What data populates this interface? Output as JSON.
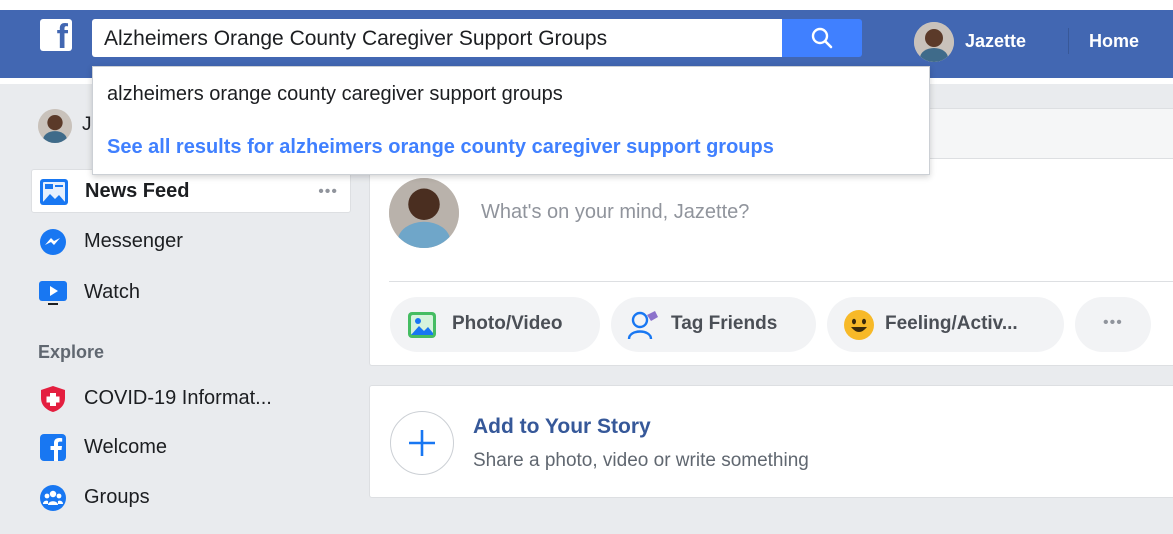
{
  "header": {
    "search_value": "Alzheimers Orange County Caregiver Support Groups",
    "user_name": "Jazette",
    "home_label": "Home"
  },
  "search_dropdown": {
    "suggestion": "alzheimers orange county caregiver support groups",
    "see_all": "See all results for alzheimers orange county caregiver support groups"
  },
  "sidebar": {
    "user_initial": "J",
    "items": [
      {
        "label": "News Feed",
        "icon": "news-feed-icon",
        "more": "•••"
      },
      {
        "label": "Messenger",
        "icon": "messenger-icon"
      },
      {
        "label": "Watch",
        "icon": "watch-icon"
      }
    ],
    "explore_heading": "Explore",
    "explore_items": [
      {
        "label": "COVID-19 Informat...",
        "icon": "covid-shield-icon"
      },
      {
        "label": "Welcome",
        "icon": "facebook-icon"
      },
      {
        "label": "Groups",
        "icon": "groups-icon"
      }
    ]
  },
  "composer": {
    "placeholder": "What's on your mind, Jazette?",
    "actions": [
      {
        "label": "Photo/Video",
        "icon": "photo-video-icon"
      },
      {
        "label": "Tag Friends",
        "icon": "tag-friends-icon"
      },
      {
        "label": "Feeling/Activ...",
        "icon": "feeling-icon"
      }
    ],
    "more": "•••"
  },
  "story": {
    "title": "Add to Your Story",
    "subtitle": "Share a photo, video or write something"
  },
  "colors": {
    "brand_blue": "#4267b2",
    "search_button": "#4080ff",
    "link_blue": "#365899"
  }
}
